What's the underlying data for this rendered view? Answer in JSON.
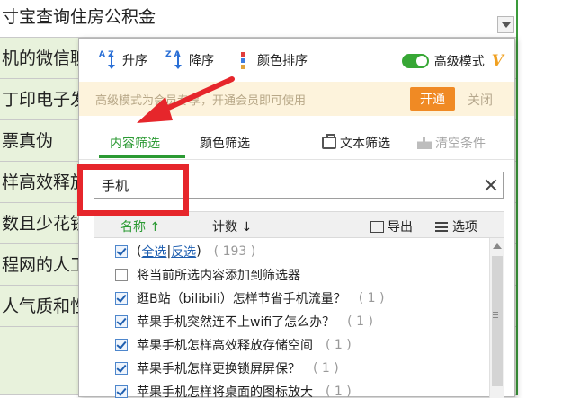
{
  "sheet": {
    "rows": [
      "寸宝查询住房公积金",
      "机的微信聊",
      "丁印电子发",
      "票真伪",
      "样高效释放",
      "数且少花钱",
      "程网的人工",
      "人气质和性"
    ]
  },
  "filter_popup": {
    "sort": {
      "asc_label": "升序",
      "desc_label": "降序",
      "color_label": "颜色排序",
      "asc_icon_letters": "A Z",
      "desc_icon_letters": "Z A"
    },
    "advanced_mode": {
      "label": "高级模式",
      "vip_icon": "V",
      "enabled": true
    },
    "promo": {
      "text": "高级模式为会员专享，开通会员即可使用",
      "open_button": "开通",
      "close_link": "关闭"
    },
    "tabs": [
      {
        "label": "内容筛选",
        "active": true
      },
      {
        "label": "颜色筛选",
        "active": false
      }
    ],
    "text_filter_label": "文本筛选",
    "clear_conditions_label": "清空条件",
    "search": {
      "value": "手机",
      "placeholder": ""
    },
    "list_header": {
      "name_label": "名称 ↑",
      "count_label": "计数 ↓",
      "export_label": "导出",
      "options_label": "选项"
    },
    "items": [
      {
        "select_all": "全选",
        "sep": "|",
        "invert": "反选",
        "pre": "(",
        "post": ")",
        "count": "( 193 )",
        "checked": true
      },
      {
        "text": "将当前所选内容添加到筛选器",
        "count": "",
        "checked": false
      },
      {
        "text": "逛B站（bilibili）怎样节省手机流量？",
        "count": "( 1 )",
        "checked": true
      },
      {
        "text": "苹果手机突然连不上wifi了怎么办？",
        "count": "( 1 )",
        "checked": true
      },
      {
        "text": "苹果手机怎样高效释放存储空间",
        "count": "( 1 )",
        "checked": true
      },
      {
        "text": "苹果手机怎样更换锁屏屏保？",
        "count": "( 1 )",
        "checked": true
      },
      {
        "text": "苹果手机怎样将桌面的图标放大",
        "count": "( 1 )",
        "checked": true
      }
    ]
  },
  "colors": {
    "accent_green": "#2b9a33",
    "promo_orange": "#f08a24",
    "annotation_red": "#e6262b",
    "link_blue": "#1f5fb0"
  }
}
